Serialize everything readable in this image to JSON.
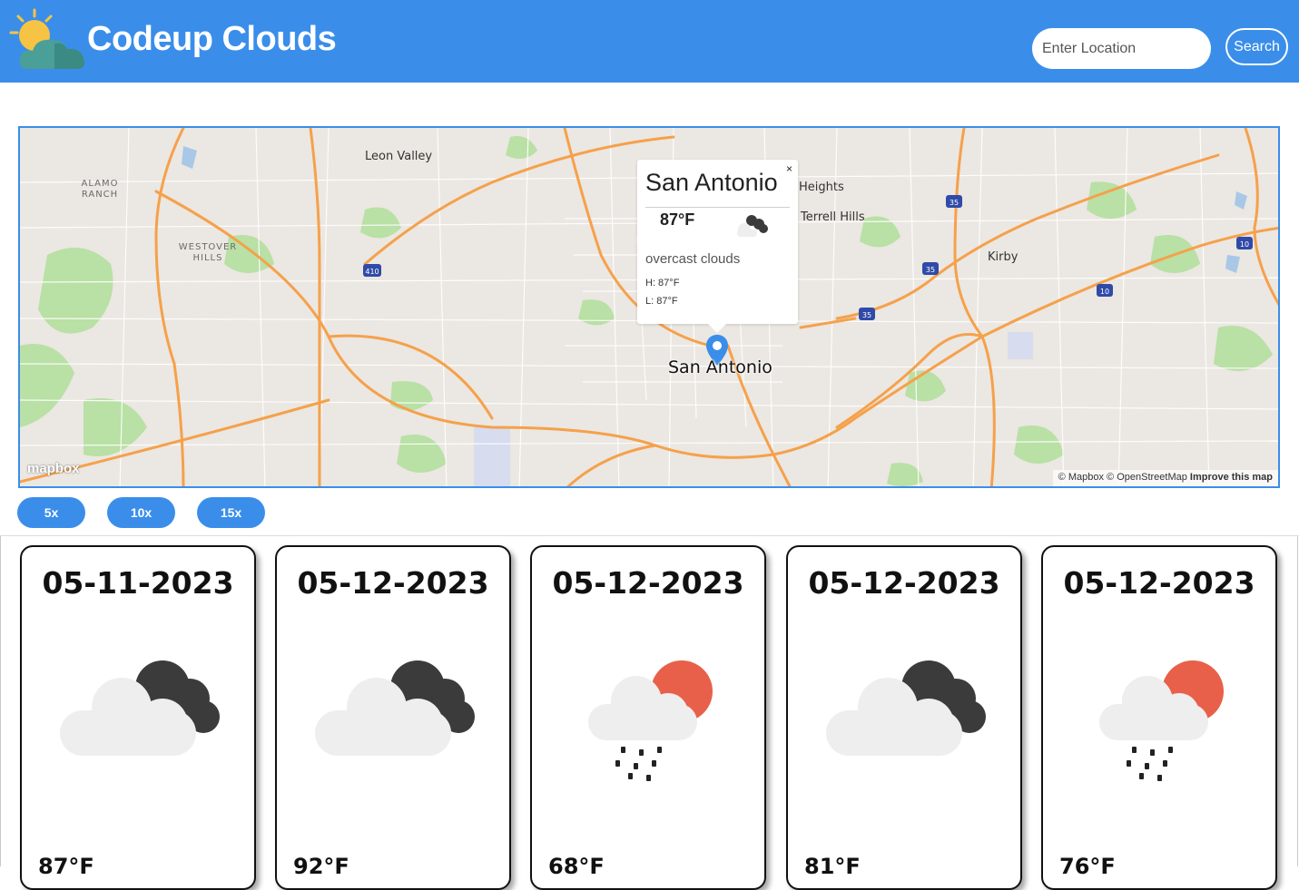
{
  "header": {
    "brand": "Codeup Clouds",
    "search_placeholder": "Enter Location",
    "search_button": "Search"
  },
  "map": {
    "labels": {
      "leon_valley": "Leon Valley",
      "alamo_ranch": "ALAMO RANCH",
      "westover_hills": "WESTOVER HILLS",
      "heights": "Heights",
      "terrell_hills": "Terrell Hills",
      "kirby": "Kirby"
    },
    "marker_label": "San Antonio",
    "popup": {
      "city": "San Antonio",
      "temp": "87°F",
      "description": "overcast clouds",
      "high": "H: 87°F",
      "low": "L: 87°F",
      "close": "×",
      "icon": "overcast-clouds-icon"
    },
    "logo": "mapbox",
    "attribution": {
      "mapbox": "© Mapbox",
      "osm": "© OpenStreetMap",
      "improve": "Improve this map"
    },
    "colors": {
      "border": "#3a8eea",
      "highway": "#f5a14b",
      "park": "#b9e0a5"
    }
  },
  "zoom_buttons": [
    "5x",
    "10x",
    "15x"
  ],
  "forecast": [
    {
      "date": "05-11-2023",
      "temp": "87°F",
      "icon": "overcast-clouds-icon"
    },
    {
      "date": "05-12-2023",
      "temp": "92°F",
      "icon": "overcast-clouds-icon"
    },
    {
      "date": "05-12-2023",
      "temp": "68°F",
      "icon": "rain-sun-icon"
    },
    {
      "date": "05-12-2023",
      "temp": "81°F",
      "icon": "overcast-clouds-icon"
    },
    {
      "date": "05-12-2023",
      "temp": "76°F",
      "icon": "rain-sun-icon"
    }
  ],
  "colors": {
    "accent": "#3a8eea",
    "sun_red": "#e8604a",
    "cloud_dark": "#3b3b3b",
    "cloud_light": "#eeeeee"
  }
}
